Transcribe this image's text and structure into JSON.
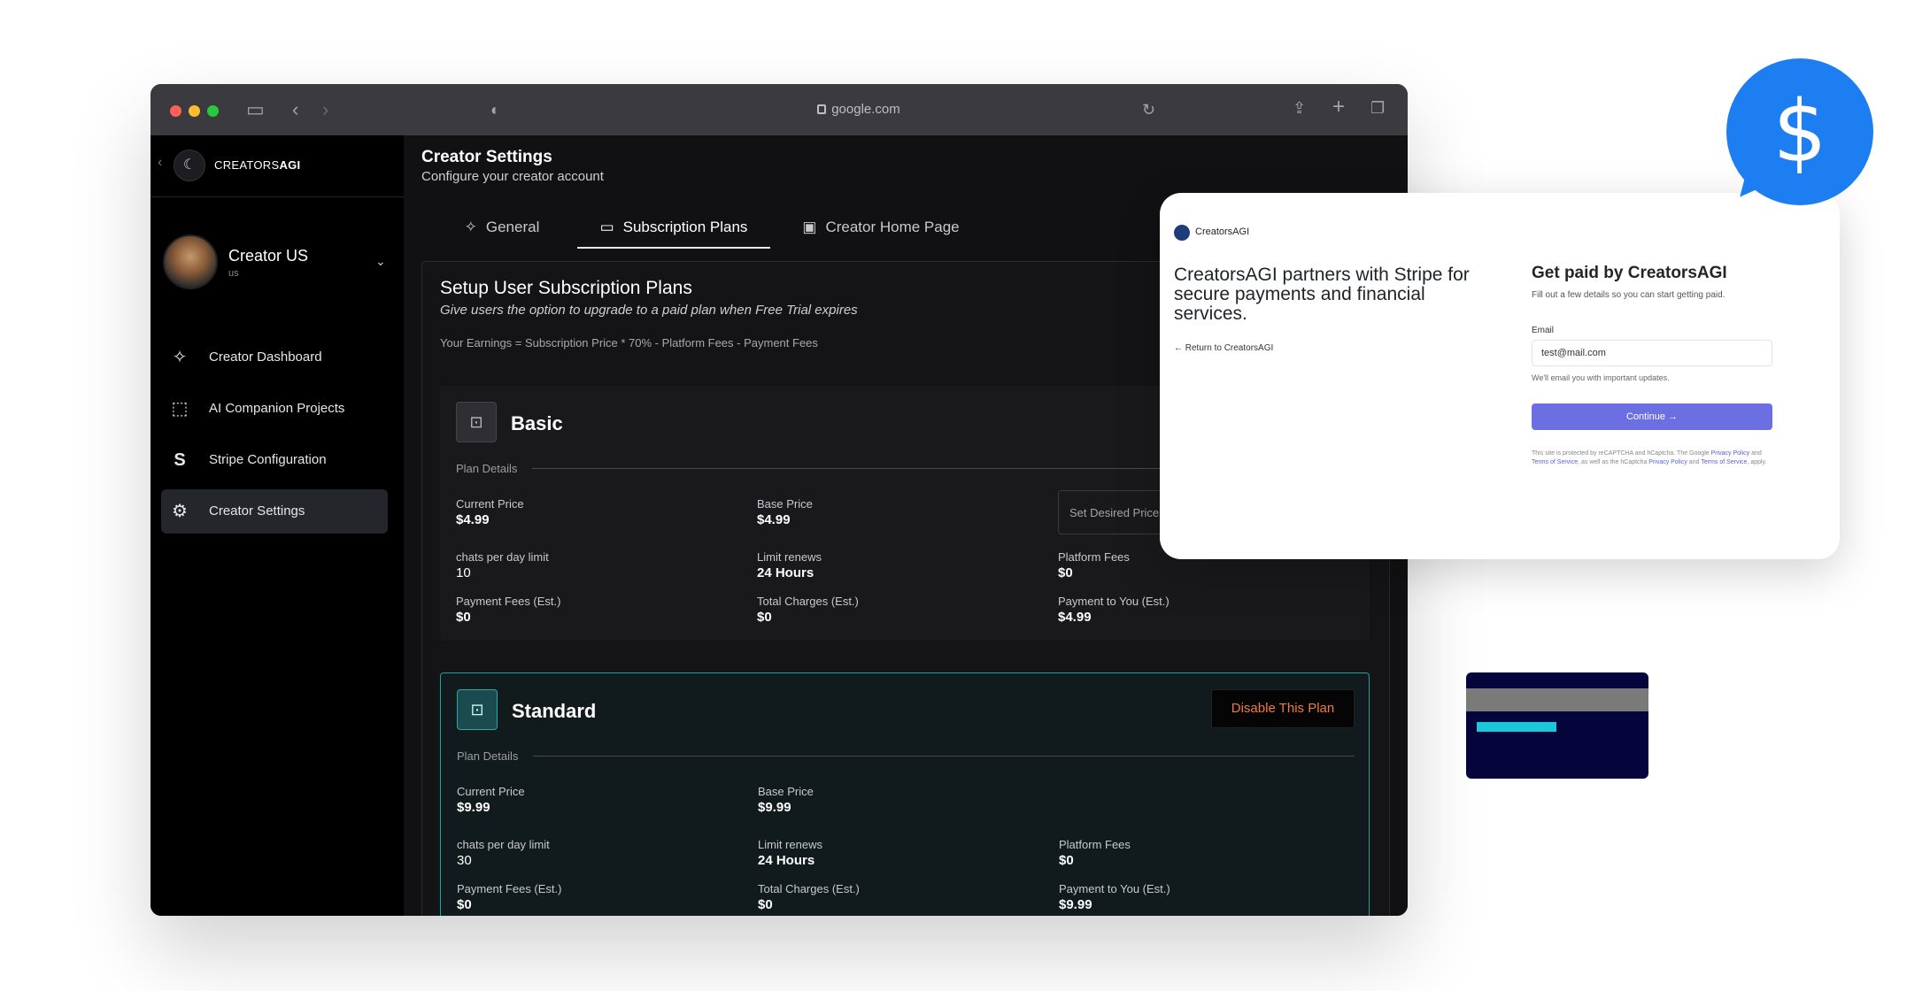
{
  "browser": {
    "url": "google.com"
  },
  "sidebar": {
    "brand_prefix": "CREATORS",
    "brand_suffix": "AGI",
    "user": {
      "name": "Creator US",
      "sub": "us"
    },
    "items": [
      {
        "label": "Creator Dashboard",
        "icon": "sparkle-icon"
      },
      {
        "label": "AI Companion Projects",
        "icon": "chart-icon"
      },
      {
        "label": "Stripe Configuration",
        "icon": "stripe-icon"
      },
      {
        "label": "Creator Settings",
        "icon": "gear-icon"
      }
    ]
  },
  "main": {
    "title": "Creator Settings",
    "subtitle": "Configure your creator account",
    "tabs": [
      {
        "label": "General"
      },
      {
        "label": "Subscription Plans"
      },
      {
        "label": "Creator Home Page"
      }
    ],
    "section_title": "Setup User Subscription Plans",
    "section_sub": "Give users the option to upgrade to a paid plan when Free Trial expires",
    "earnings": "Your Earnings = Subscription Price * 70% - Platform Fees - Payment Fees",
    "plan_details_label": "Plan Details",
    "labels": {
      "current_price": "Current Price",
      "base_price": "Base Price",
      "chats": " chats per day limit",
      "limit_renews": "Limit renews",
      "platform_fees": "Platform Fees",
      "payment_fees": "Payment Fees (Est.)",
      "total_charges": "Total Charges (Est.)",
      "payment_to_you": "Payment to You (Est.)"
    },
    "plans": [
      {
        "name": "Basic",
        "current_price": "$4.99",
        "base_price": "$4.99",
        "chats": "10",
        "limit_renews": "24 Hours",
        "platform_fees": "$0",
        "payment_fees": "$0",
        "total_charges": "$0",
        "payment_to_you": "$4.99",
        "desired_price_placeholder": "Set Desired Price"
      },
      {
        "name": "Standard",
        "current_price": "$9.99",
        "base_price": "$9.99",
        "chats": "30",
        "limit_renews": "24 Hours",
        "platform_fees": "$0",
        "payment_fees": "$0",
        "total_charges": "$0",
        "payment_to_you": "$9.99",
        "disable_label": "Disable This Plan"
      }
    ]
  },
  "stripe": {
    "brand": "CreatorsAGI",
    "headline": "CreatorsAGI partners with Stripe for secure payments and financial services.",
    "return_link": "← Return to CreatorsAGI",
    "title": "Get paid by CreatorsAGI",
    "desc": "Fill out a few details so you can start getting paid.",
    "email_label": "Email",
    "email_value": "test@mail.com",
    "email_note": "We'll email you with important updates.",
    "continue_label": "Continue →",
    "legal_1": "This site is protected by reCAPTCHA and hCaptcha. The Google ",
    "legal_pp1": "Privacy Policy",
    "legal_and1": " and ",
    "legal_tos1": "Terms of Service",
    "legal_2": ", as well as the hCaptcha ",
    "legal_pp2": "Privacy Policy",
    "legal_and2": " and ",
    "legal_tos2": "Terms of Service",
    "legal_3": ", apply."
  },
  "decor": {
    "bubble_symbol": "$"
  }
}
